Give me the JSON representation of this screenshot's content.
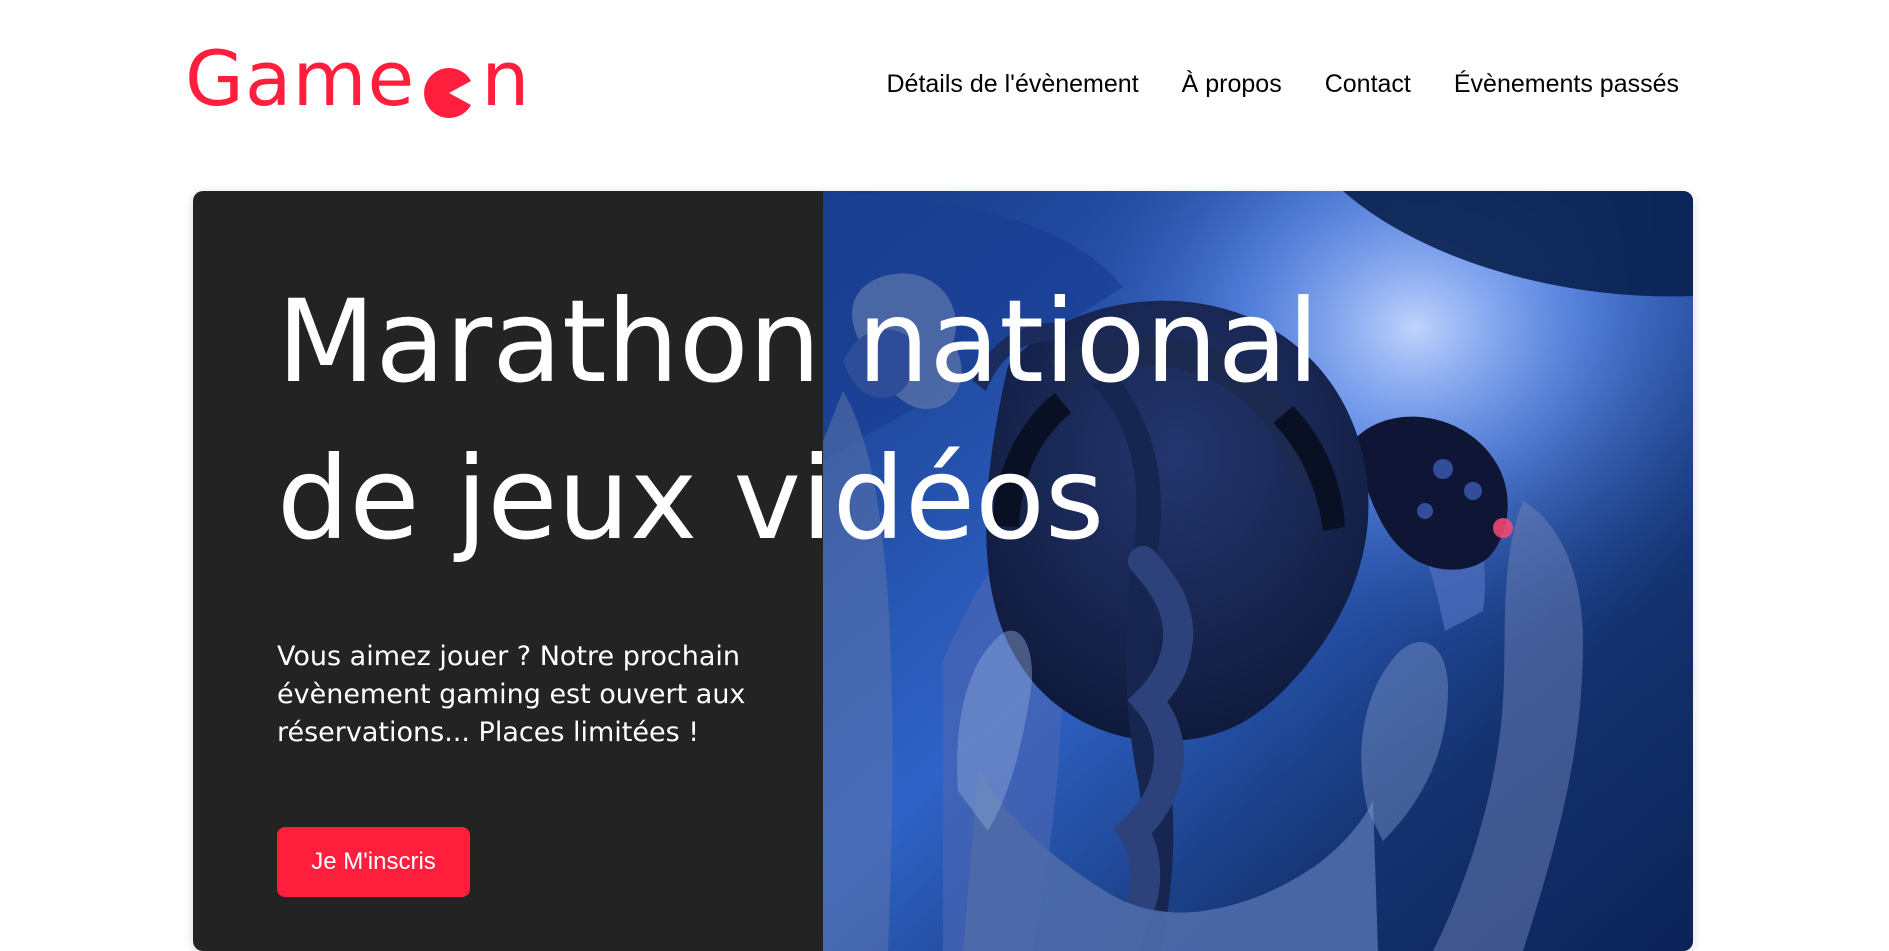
{
  "brand": {
    "logo_before": "Game",
    "logo_after": "n",
    "color": "#ff1f3d"
  },
  "nav": {
    "items": [
      {
        "label": "Détails de l'évènement"
      },
      {
        "label": "À propos"
      },
      {
        "label": "Contact"
      },
      {
        "label": "Évènements passés"
      }
    ]
  },
  "hero": {
    "title_line1": "Marathon national",
    "title_line2": "de jeux vidéos",
    "text": "Vous aimez jouer ? Notre prochain évènement gaming est ouvert aux réservations... Places limitées !",
    "cta_label": "Je M'inscris",
    "panel_color": "#232323",
    "cta_color": "#ff1f3d"
  }
}
